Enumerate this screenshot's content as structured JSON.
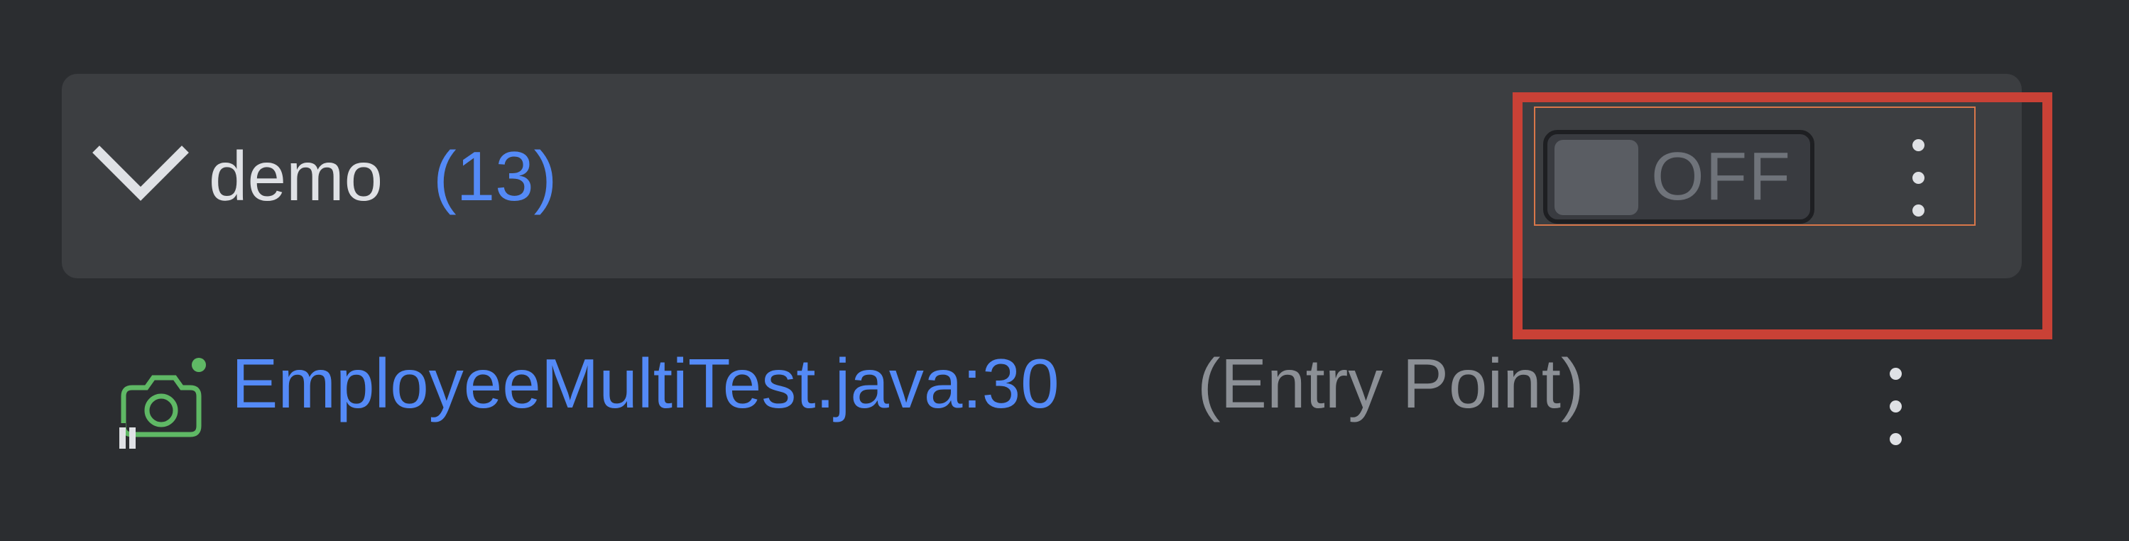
{
  "group": {
    "name": "demo",
    "count": "(13)",
    "toggle_label": "OFF",
    "toggle_state": "off"
  },
  "entry": {
    "location": "EmployeeMultiTest.java:30",
    "suffix": "(Entry Point)"
  },
  "icons": {
    "expand": "chevron-down-icon",
    "entry": "camera-snapshot-icon",
    "menu": "more-vertical-icon"
  },
  "colors": {
    "background": "#2b2d30",
    "header_background": "#3c3e41",
    "text": "#dfe1e5",
    "link": "#548af7",
    "muted": "#8c9096",
    "highlight": "#c94136",
    "icon_green": "#5fb865"
  }
}
